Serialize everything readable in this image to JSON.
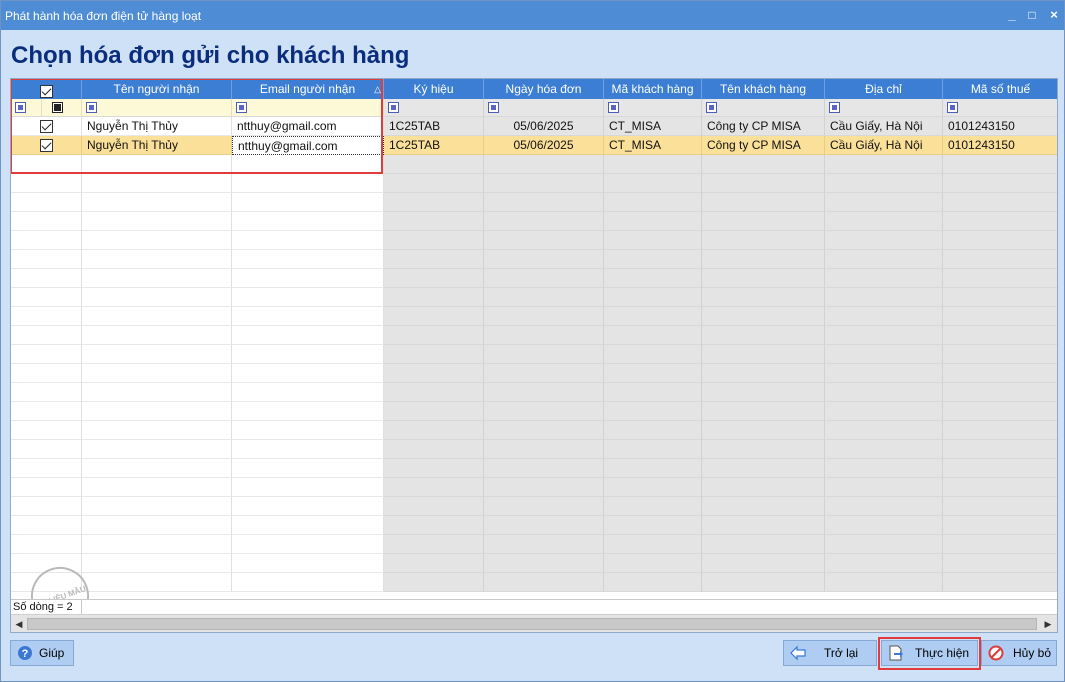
{
  "window": {
    "title": "Phát hành hóa đơn điện tử hàng loạt",
    "controls": [
      "_",
      "□",
      "×"
    ]
  },
  "heading": "Chọn hóa đơn gửi cho khách hàng",
  "grid": {
    "columns": {
      "select": "",
      "recipient_name": "Tên người nhận",
      "recipient_email": "Email người nhận",
      "symbol": "Ký hiệu",
      "invoice_date": "Ngày hóa đơn",
      "customer_code": "Mã khách hàng",
      "customer_name": "Tên khách hàng",
      "address": "Địa chỉ",
      "tax_code": "Mã số thuế"
    },
    "rows": [
      {
        "checked": true,
        "recipient_name": "Nguyễn Thị Thủy",
        "recipient_email": "ntthuy@gmail.com",
        "symbol": "1C25TAB",
        "invoice_date": "05/06/2025",
        "customer_code": "CT_MISA",
        "customer_name": "Công ty CP MISA",
        "address": "Cầu Giấy, Hà Nội",
        "tax_code": "0101243150"
      },
      {
        "checked": true,
        "recipient_name": "Nguyễn Thị Thủy",
        "recipient_email": "ntthuy@gmail.com",
        "symbol": "1C25TAB",
        "invoice_date": "05/06/2025",
        "customer_code": "CT_MISA",
        "customer_name": "Công ty CP MISA",
        "address": "Cầu Giấy, Hà Nội",
        "tax_code": "0101243150"
      }
    ],
    "row_count_label": "Số dòng = 2",
    "watermark": "DỮ LIỆU MẪU"
  },
  "buttons": {
    "help": "Giúp",
    "back": "Trở lại",
    "execute": "Thực hiện",
    "cancel": "Hủy bỏ"
  },
  "colors": {
    "title_bar": "#4f8cd6",
    "header": "#3b7ed3",
    "heading_text": "#0a2d7e",
    "selected_row": "#fbe09a",
    "highlight_border": "#e23b3b"
  }
}
